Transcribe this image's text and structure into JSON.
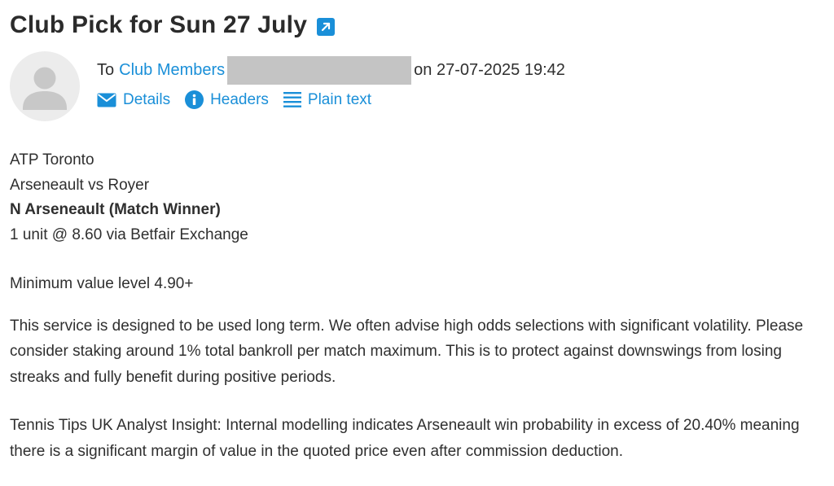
{
  "email": {
    "subject": "Club Pick for Sun 27 July",
    "to_prefix": "To",
    "recipient": "Club Members",
    "date_text": "on 27-07-2025 19:42"
  },
  "actions": {
    "details_label": "Details",
    "headers_label": "Headers",
    "plain_text_label": "Plain text"
  },
  "icons": {
    "subject_link": "external-link-icon",
    "avatar": "user-avatar-icon",
    "details": "envelope-icon",
    "headers": "info-icon",
    "plain_text": "lines-icon"
  },
  "colors": {
    "link": "#1a8fd8",
    "text": "#2f2f2f",
    "redaction": "#c4c4c4",
    "avatar_bg": "#ececec",
    "avatar_fg": "#c8c8c8"
  },
  "body": {
    "line1": "ATP Toronto",
    "line2": "Arseneault vs Royer",
    "line3": "N Arseneault (Match Winner)",
    "line4": "1 unit @ 8.60 via Betfair Exchange",
    "min_value": "Minimum value level 4.90+",
    "disclaimer": "This service is designed to be used long term. We often advise high odds selections with significant volatility. Please consider staking around 1% total bankroll per match maximum. This is to protect against downswings from losing streaks and fully benefit during positive periods.",
    "insight": "Tennis Tips UK Analyst Insight: Internal modelling indicates Arseneault win probability in excess of 20.40% meaning there is a significant margin of value in the quoted price even after commission deduction."
  }
}
